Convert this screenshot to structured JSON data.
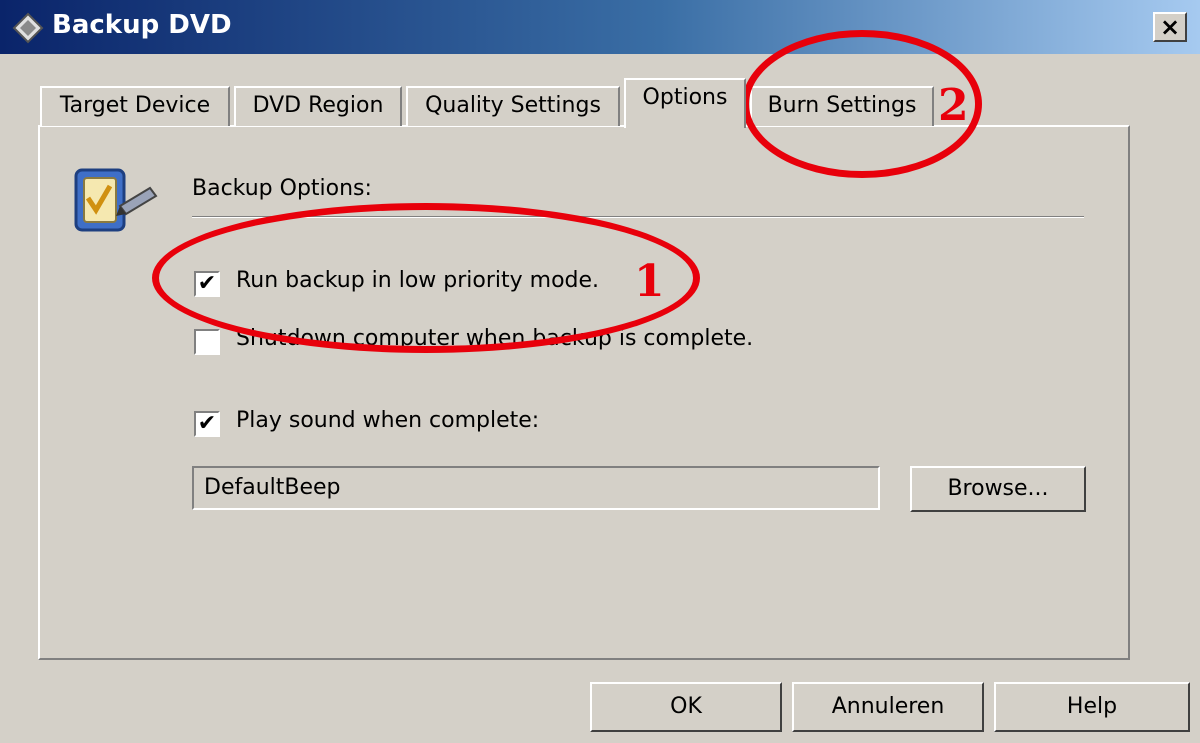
{
  "window": {
    "title": "Backup DVD",
    "close_label": "×"
  },
  "tabs": [
    {
      "label": "Target Device"
    },
    {
      "label": "DVD Region"
    },
    {
      "label": "Quality Settings"
    },
    {
      "label": "Options",
      "active": true
    },
    {
      "label": "Burn Settings"
    }
  ],
  "options": {
    "group_label": "Backup Options:",
    "checkboxes": [
      {
        "label": "Run backup in low priority mode.",
        "checked": true
      },
      {
        "label": "Shutdown computer when backup is complete.",
        "checked": false
      },
      {
        "label": "Play sound when complete:",
        "checked": true
      }
    ],
    "sound_value": "DefaultBeep",
    "browse_label": "Browse..."
  },
  "footer": {
    "ok_label": "OK",
    "cancel_label": "Annuleren",
    "help_label": "Help"
  },
  "annotations": {
    "marker_1": "1",
    "marker_2": "2",
    "color": "#e8000b"
  },
  "check_glyph": "✔"
}
